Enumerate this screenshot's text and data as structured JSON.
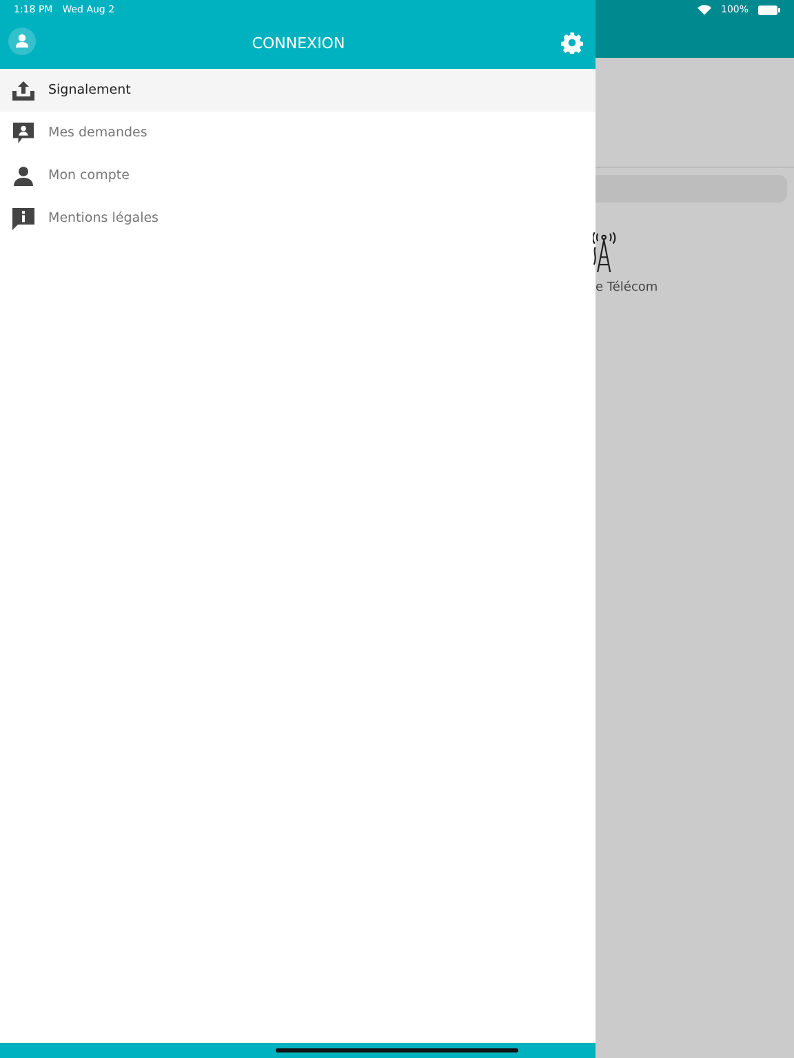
{
  "status_bar": {
    "time": "1:18 PM",
    "date": "Wed Aug 2",
    "battery": "100%"
  },
  "drawer": {
    "title": "CONNEXION",
    "items": [
      {
        "kind": "upload",
        "label": "Signalement",
        "selected": true
      },
      {
        "kind": "requests",
        "label": "Mes demandes",
        "selected": false
      },
      {
        "kind": "account",
        "label": "Mon compte",
        "selected": false
      },
      {
        "kind": "info",
        "label": "Mentions légales",
        "selected": false
      }
    ]
  },
  "background": {
    "category_label": "e Télécom"
  }
}
